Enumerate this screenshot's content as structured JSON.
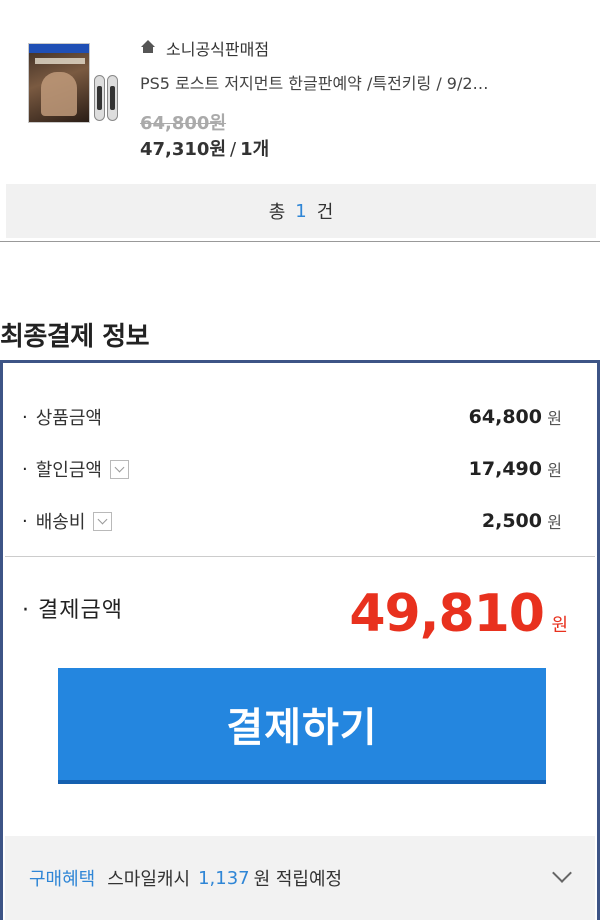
{
  "product": {
    "store_name": "소니공식판매점",
    "name": "PS5 로스트 저지먼트 한글판예약 /특전키링 / 9/2…",
    "original_price": "64,800원",
    "sale_price": "47,310원",
    "separator": "/",
    "quantity": "1개"
  },
  "total": {
    "prefix": "총",
    "count": "1",
    "suffix": "건"
  },
  "payment": {
    "title": "최종결제 정보",
    "rows": [
      {
        "label": "상품금액",
        "amount": "64,800",
        "unit": "원"
      },
      {
        "label": "할인금액",
        "amount": "17,490",
        "unit": "원"
      },
      {
        "label": "배송비",
        "amount": "2,500",
        "unit": "원"
      }
    ],
    "final_label": "결제금액",
    "final_amount": "49,810",
    "final_unit": "원",
    "pay_button": "결제하기"
  },
  "benefit": {
    "tag": "구매혜택",
    "text1": "스마일캐시",
    "points": "1,137",
    "text2": "원 적립예정"
  },
  "colors": {
    "accent_blue": "#2486df",
    "price_red": "#e8311e",
    "border_navy": "#3d5486"
  }
}
